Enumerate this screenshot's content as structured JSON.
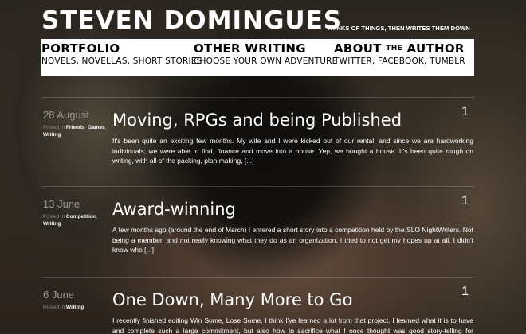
{
  "site": {
    "title": "STEVEN DOMINGUES",
    "tagline": "THINKS OF THINGS, THEN WRITES THEM DOWN"
  },
  "nav": {
    "portfolio": {
      "title": "PORTFOLIO",
      "sub": "NOVELS, NOVELLAS, SHORT STORIES"
    },
    "other_writing": {
      "title": "OTHER WRITING",
      "sub": "CHOOSE YOUR OWN ADVENTURE"
    },
    "about": {
      "title_a": "ABOUT",
      "title_the": "THE",
      "title_b": "AUTHOR",
      "sub": "TWITTER, FACEBOOK, TUMBLR"
    }
  },
  "posts": [
    {
      "date": "28 August",
      "posted_in": "Posted in",
      "categories": [
        "Friends",
        "Games",
        "Writing"
      ],
      "comment_count": "1",
      "title": "Moving, RPGs and being Published",
      "excerpt": "It's been quite an exciting few months. My wife and I were kicked out of our rental, and since we are hardworking individuals, we were able to find, finance and move into a house. Yep, we bought a house. It's been quite rough on writing, with all of the packing, plan making, [...]"
    },
    {
      "date": "13 June",
      "posted_in": "Posted in",
      "categories": [
        "Competition",
        "Writing"
      ],
      "comment_count": "1",
      "title": "Award-winning",
      "excerpt": "A few months ago (around the end of March) I entered a short story into a competition held by the SLO NightWriters. Not being a member, and not really knowing what they do as an organization, I tried to not get my hopes up at all. I didn't know who [...]"
    },
    {
      "date": "6 June",
      "posted_in": "Posted in",
      "categories": [
        "Writing"
      ],
      "comment_count": "1",
      "title": "One Down, Many More to Go",
      "excerpt": "I recently finished editing Win Some, Lose Some. I think I've learned a lot from that project. I learned what it is to have and complete such a large commitment, but also how to sacrifice what I once thought was good story-telling for something that"
    }
  ]
}
